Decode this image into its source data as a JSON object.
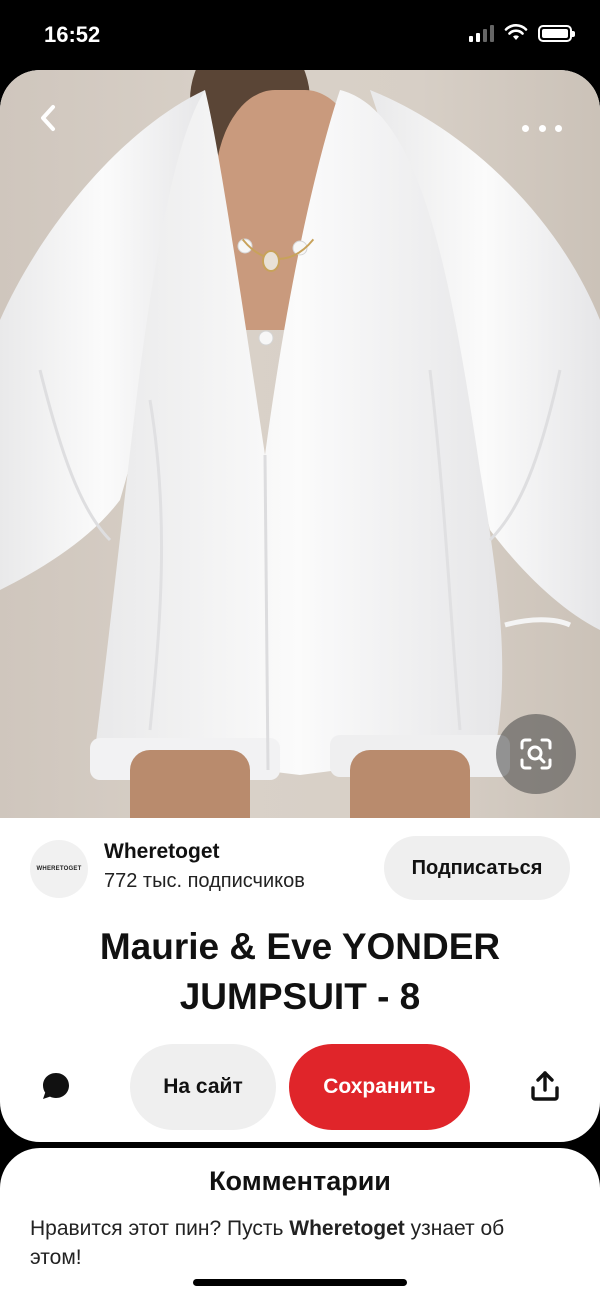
{
  "status_bar": {
    "time": "16:52"
  },
  "pin": {
    "creator_name": "Wheretoget",
    "avatar_text": "WHERETOGET",
    "followers": "772 тыс. подписчиков",
    "follow_label": "Подписаться",
    "title": "Maurie & Eve YONDER JUMPSUIT - 8"
  },
  "actions": {
    "visit_label": "На сайт",
    "save_label": "Сохранить"
  },
  "comments": {
    "title": "Комментарии",
    "prompt_before": "Нравится этот пин? Пусть ",
    "prompt_name": "Wheretoget",
    "prompt_after": " узнает об этом!"
  },
  "icons": {
    "back": "chevron-left-icon",
    "more": "more-dots-icon",
    "visual_search": "visual-search-icon",
    "comment": "comment-bubble-icon",
    "share": "share-icon"
  },
  "colors": {
    "save_button": "#e0252a",
    "secondary_button": "#efefef"
  }
}
